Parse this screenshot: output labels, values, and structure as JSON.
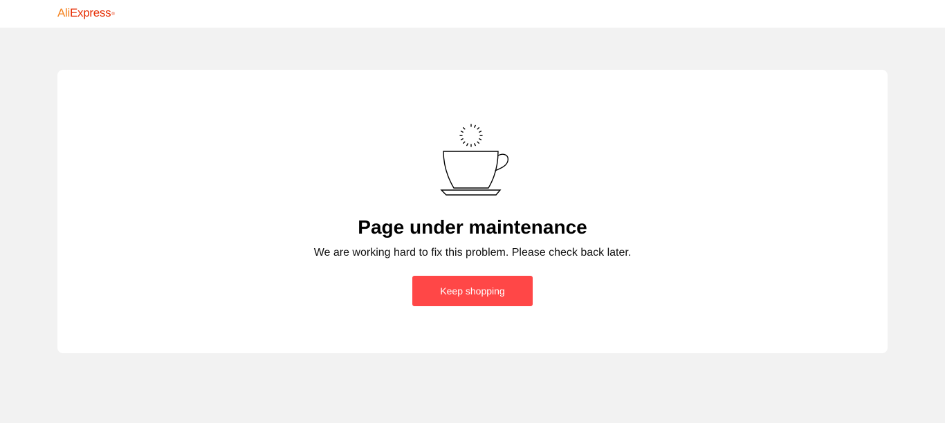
{
  "header": {
    "logo": {
      "part1": "Ali",
      "part2": "Express",
      "reg_mark": "®",
      "colors": {
        "ali": "#f5831f",
        "express": "#e62e04"
      }
    }
  },
  "main": {
    "illustration_icon": "coffee-cup-icon",
    "title": "Page under maintenance",
    "message": "We are working hard to fix this problem. Please check back later.",
    "button_label": "Keep shopping",
    "button_color": "#ff4747"
  }
}
